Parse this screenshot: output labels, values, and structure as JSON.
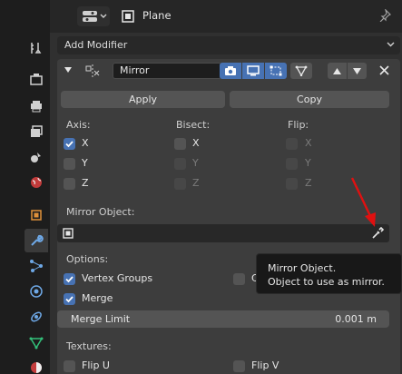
{
  "header": {
    "title": "Plane"
  },
  "toolbar": {
    "add_modifier_label": "Add Modifier"
  },
  "modifier": {
    "name": "Mirror",
    "apply_label": "Apply",
    "copy_label": "Copy",
    "axis_label": "Axis:",
    "bisect_label": "Bisect:",
    "flip_label": "Flip:",
    "axis": [
      {
        "label": "X",
        "checked": true
      },
      {
        "label": "Y",
        "checked": false
      },
      {
        "label": "Z",
        "checked": false
      }
    ],
    "bisect": [
      {
        "label": "X",
        "checked": false
      },
      {
        "label": "Y",
        "checked": false
      },
      {
        "label": "Z",
        "checked": false
      }
    ],
    "flip": [
      {
        "label": "X",
        "checked": false
      },
      {
        "label": "Y",
        "checked": false
      },
      {
        "label": "Z",
        "checked": false
      }
    ],
    "mirror_object_label": "Mirror Object:",
    "options_label": "Options:",
    "vertex_groups_label": "Vertex Groups",
    "clipping_label_partial": "C",
    "merge_label": "Merge",
    "merge_limit_label": "Merge Limit",
    "merge_limit_value": "0.001 m",
    "textures_label": "Textures:",
    "flip_u_label": "Flip U",
    "flip_v_label": "Flip V"
  },
  "tooltip": {
    "title": "Mirror Object.",
    "description": "Object to use as mirror."
  },
  "colors": {
    "accent": "#4772b3",
    "panel": "#3d3d3d",
    "background": "#303030",
    "annotation_arrow": "#e01010"
  }
}
